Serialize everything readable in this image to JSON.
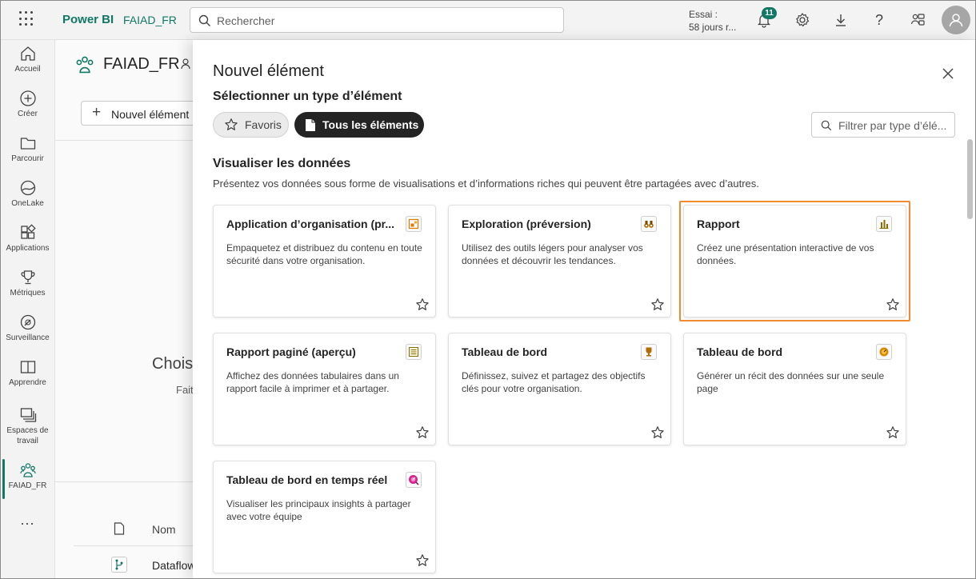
{
  "topbar": {
    "brand": "Power BI",
    "workspace": "FAIAD_FR",
    "search_placeholder": "Rechercher",
    "trial_line1": "Essai :",
    "trial_line2": "58 jours r...",
    "notification_count": "11",
    "icons": [
      "app-launcher-icon",
      "bell-icon",
      "gear-icon",
      "download-icon",
      "help-icon",
      "share-feedback-icon",
      "user-avatar-icon"
    ],
    "accent": "#117865"
  },
  "nav": {
    "items": [
      {
        "label": "Accueil",
        "icon": "home-icon"
      },
      {
        "label": "Créer",
        "icon": "plus-circle-icon"
      },
      {
        "label": "Parcourir",
        "icon": "folder-icon"
      },
      {
        "label": "OneLake",
        "icon": "onelake-icon"
      },
      {
        "label": "Applications",
        "icon": "apps-icon"
      },
      {
        "label": "Métriques",
        "icon": "trophy-icon"
      },
      {
        "label": "Surveillance",
        "icon": "monitor-icon"
      },
      {
        "label": "Apprendre",
        "icon": "book-icon"
      },
      {
        "label": "Espaces de travail",
        "icon": "workspaces-icon"
      },
      {
        "label": "FAIAD_FR",
        "icon": "workspace-people-icon"
      }
    ],
    "more": "...",
    "active": "FAIAD_FR"
  },
  "workspace": {
    "title": "FAIAD_FR",
    "new_item_button": "Nouvel élément",
    "empty_title": "Chois",
    "empty_subtitle": "Fait",
    "column_name": "Nom",
    "row_name": "Dataflow"
  },
  "panel": {
    "title": "Nouvel élément",
    "subtitle": "Sélectionner un type d’élément",
    "filter_favorites": "Favoris",
    "filter_all": "Tous les éléments",
    "filter_placeholder": "Filtrer par type d’élé...",
    "section_title": "Visualiser les données",
    "section_desc": "Présentez vos données sous forme de visualisations et d’informations riches qui peuvent être partagées avec d’autres.",
    "selected_outline_color": "#f28a30",
    "cards": [
      {
        "title": "Application d’organisation (pr...",
        "desc": "Empaquetez et distribuez du contenu en toute sécurité dans votre organisation.",
        "icon": "org-app-icon",
        "icon_color": "#e07b00"
      },
      {
        "title": "Exploration (préversion)",
        "desc": "Utilisez des outils légers pour analyser vos données et découvrir les tendances.",
        "icon": "binoculars-icon",
        "icon_color": "#b36b00"
      },
      {
        "title": "Rapport",
        "desc": "Créez une présentation interactive de vos données.",
        "icon": "report-icon",
        "icon_color": "#8a6d00"
      },
      {
        "title": "Rapport paginé (aperçu)",
        "desc": "Affichez des données tabulaires dans un rapport facile à imprimer et à partager.",
        "icon": "paginated-report-icon",
        "icon_color": "#8a6d00"
      },
      {
        "title": "Tableau de bord",
        "desc": "Définissez, suivez et partagez des objectifs clés pour votre organisation.",
        "icon": "trophy-scorecard-icon",
        "icon_color": "#b36b00"
      },
      {
        "title": "Tableau de bord",
        "desc": "Générer un récit des données sur une seule page",
        "icon": "dashboard-gauge-icon",
        "icon_color": "#d48a00"
      },
      {
        "title": "Tableau de bord en temps réel",
        "desc": "Visualiser les principaux insights à partager avec votre équipe",
        "icon": "realtime-dashboard-icon",
        "icon_color": "#d6248f"
      }
    ]
  }
}
